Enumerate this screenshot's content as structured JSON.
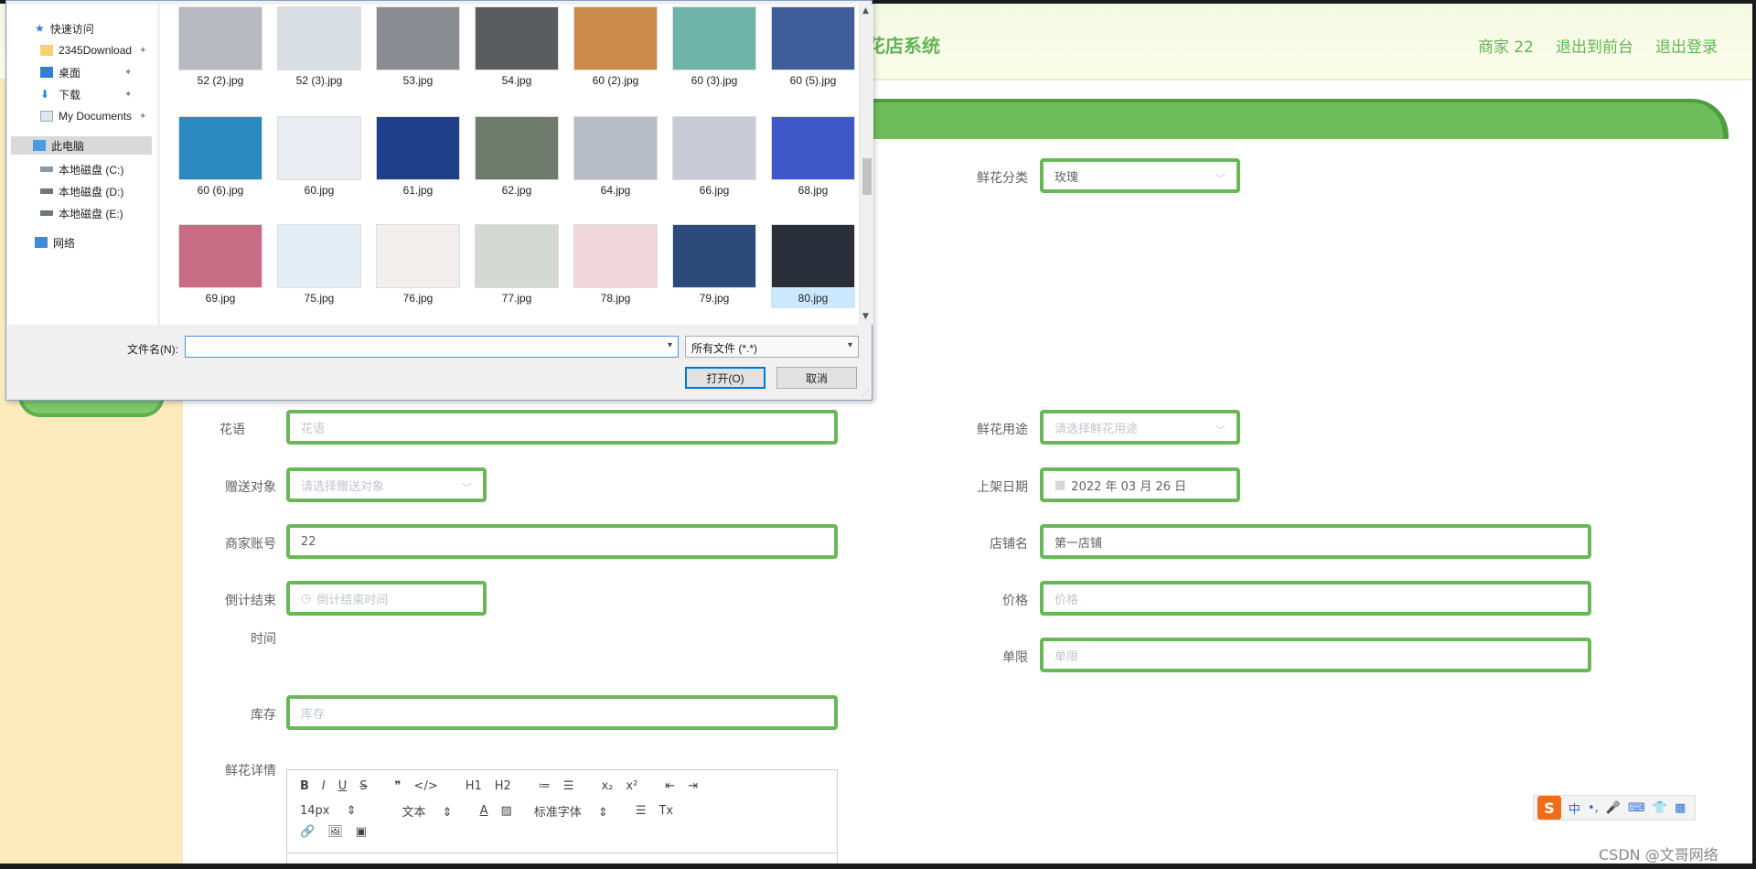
{
  "header": {
    "site_title": "花店系统",
    "nav": [
      "商家 22",
      "退出到前台",
      "退出登录"
    ]
  },
  "form": {
    "category_label": "鲜花分类",
    "category_value": "玫瑰",
    "language_label": "花语",
    "language_placeholder": "花语",
    "usage_label": "鲜花用途",
    "usage_placeholder": "请选择鲜花用途",
    "gift_label": "赠送对象",
    "gift_placeholder": "请选择赠送对象",
    "date_label": "上架日期",
    "date_value": "2022 年 03 月 26 日",
    "merchant_label": "商家账号",
    "merchant_value": "22",
    "shop_label": "店铺名",
    "shop_value": "第一店铺",
    "countdown_label_1": "倒计结束",
    "countdown_label_2": "时间",
    "countdown_placeholder": "倒计结束时间",
    "price_label": "价格",
    "price_placeholder": "价格",
    "limit_label": "单限",
    "limit_placeholder": "单限",
    "stock_label": "库存",
    "stock_placeholder": "库存",
    "detail_label": "鲜花详情"
  },
  "editor": {
    "row1": [
      "B",
      "I",
      "U",
      "S",
      "❞",
      "</>",
      "H1",
      "H2",
      "≔",
      "☰",
      "x₂",
      "x²",
      "⇤",
      "⇥"
    ],
    "font_size": "14px",
    "text_style": "文本",
    "font_family": "标准字体",
    "row3": [
      "🔗",
      "🖼",
      "▣"
    ]
  },
  "dialog": {
    "tree": {
      "quick_access": "快速访问",
      "item1": "2345Download",
      "item2": "桌面",
      "item3": "下载",
      "item4": "My Documents",
      "this_pc": "此电脑",
      "drive_c": "本地磁盘 (C:)",
      "drive_d": "本地磁盘 (D:)",
      "drive_e": "本地磁盘 (E:)",
      "network": "网络"
    },
    "files": [
      {
        "name": "52 (2).jpg",
        "color": "#b8b8c0"
      },
      {
        "name": "52 (3).jpg",
        "color": "#d9dde4"
      },
      {
        "name": "53.jpg",
        "color": "#8a8d92"
      },
      {
        "name": "54.jpg",
        "color": "#5a5c60"
      },
      {
        "name": "60 (2).jpg",
        "color": "#c98a4a"
      },
      {
        "name": "60 (3).jpg",
        "color": "#6fb3a8"
      },
      {
        "name": "60 (5).jpg",
        "color": "#3e5d9a"
      },
      {
        "name": "60 (6).jpg",
        "color": "#2a8ac0"
      },
      {
        "name": "60.jpg",
        "color": "#e9edf2"
      },
      {
        "name": "61.jpg",
        "color": "#1f3f8a"
      },
      {
        "name": "62.jpg",
        "color": "#6e7a6b"
      },
      {
        "name": "64.jpg",
        "color": "#b7bcc4"
      },
      {
        "name": "66.jpg",
        "color": "#c9ccd6"
      },
      {
        "name": "68.jpg",
        "color": "#3f58c8"
      },
      {
        "name": "69.jpg",
        "color": "#c86b85"
      },
      {
        "name": "75.jpg",
        "color": "#e3edf6"
      },
      {
        "name": "76.jpg",
        "color": "#f2eeee"
      },
      {
        "name": "77.jpg",
        "color": "#d4d8d4"
      },
      {
        "name": "78.jpg",
        "color": "#f0d6dc"
      },
      {
        "name": "79.jpg",
        "color": "#2c4a7a"
      },
      {
        "name": "80.jpg",
        "color": "#2a2e3a"
      }
    ],
    "filename_label": "文件名(N):",
    "filename_value": "",
    "filetype_value": "所有文件 (*.*)",
    "open_button": "打开(O)",
    "cancel_button": "取消"
  },
  "ime": {
    "logo": "S",
    "items": [
      "中",
      "•,",
      "🎤",
      "⌨",
      "👕",
      "▦"
    ]
  },
  "watermark": "CSDN @文哥网络"
}
